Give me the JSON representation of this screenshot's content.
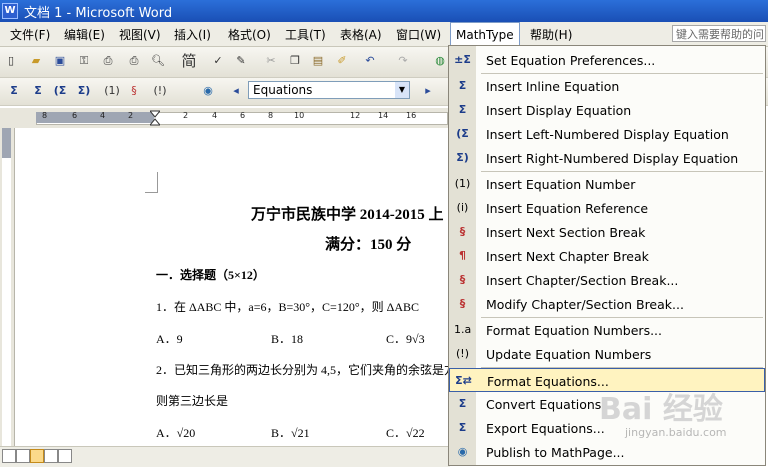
{
  "window": {
    "title": "文档 1 - Microsoft Word"
  },
  "menubar": {
    "items": [
      "文件(F)",
      "编辑(E)",
      "视图(V)",
      "插入(I)",
      "格式(O)",
      "工具(T)",
      "表格(A)",
      "窗口(W)",
      "MathType",
      "帮助(H)"
    ],
    "help_placeholder": "键入需要帮助的问"
  },
  "toolbar": {
    "style_dropdown": "Equations",
    "font_glyph": "简"
  },
  "ruler": {
    "ticks": [
      "8",
      "6",
      "4",
      "2",
      "2",
      "4",
      "6",
      "8",
      "10",
      "12",
      "14",
      "16"
    ]
  },
  "document": {
    "title": "万宁市民族中学 2014-2015 上",
    "subtitle": "满分：150 分",
    "section": "一．选择题（5×12）",
    "q1": "1．在 ΔABC 中，a=6，B=30°，C=120°，则 ΔABC",
    "q1_opts": [
      "A．9",
      "B．18",
      "C．9√3"
    ],
    "q2": "2．已知三角形的两边长分别为 4,5，它们夹角的余弦是方",
    "q2b": "则第三边长是",
    "q2_opts": [
      "A．√20",
      "B．√21",
      "C．√22"
    ]
  },
  "mathtype_menu": {
    "items": [
      {
        "label": "Set Equation Preferences...",
        "icon": "preferences-icon",
        "glyph": "±Σ"
      },
      {
        "label": "Insert Inline Equation",
        "icon": "inline-equation-icon",
        "glyph": "Σ"
      },
      {
        "label": "Insert Display Equation",
        "icon": "display-equation-icon",
        "glyph": "Σ"
      },
      {
        "label": "Insert Left-Numbered Display Equation",
        "icon": "left-numbered-icon",
        "glyph": "(Σ"
      },
      {
        "label": "Insert Right-Numbered Display Equation",
        "icon": "right-numbered-icon",
        "glyph": "Σ)"
      },
      {
        "label": "Insert Equation Number",
        "icon": "equation-number-icon",
        "glyph": "(1)"
      },
      {
        "label": "Insert Equation Reference",
        "icon": "equation-reference-icon",
        "glyph": "(i)"
      },
      {
        "label": "Insert Next Section Break",
        "icon": "section-break-icon",
        "glyph": "§"
      },
      {
        "label": "Insert Next Chapter Break",
        "icon": "chapter-break-icon",
        "glyph": "¶"
      },
      {
        "label": "Insert Chapter/Section Break...",
        "icon": "chapter-section-break-icon",
        "glyph": "§"
      },
      {
        "label": "Modify Chapter/Section Break...",
        "icon": "modify-break-icon",
        "glyph": "§"
      },
      {
        "label": "Format Equation Numbers...",
        "icon": "format-numbers-icon",
        "glyph": "1.a"
      },
      {
        "label": "Update Equation Numbers",
        "icon": "update-numbers-icon",
        "glyph": "(!)"
      },
      {
        "label": "Format Equations...",
        "icon": "format-equations-icon",
        "glyph": "Σ⇄"
      },
      {
        "label": "Convert Equations",
        "icon": "convert-equations-icon",
        "glyph": "Σ"
      },
      {
        "label": "Export Equations...",
        "icon": "export-equations-icon",
        "glyph": "Σ"
      },
      {
        "label": "Publish to MathPage...",
        "icon": "publish-icon",
        "glyph": "◉"
      }
    ],
    "highlighted": "Format Equations..."
  },
  "watermark": {
    "brand": "Bai 经验",
    "url": "jingyan.baidu.com"
  }
}
